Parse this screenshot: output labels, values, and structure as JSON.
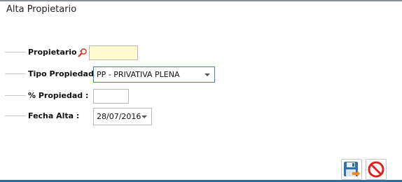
{
  "dialog": {
    "title": "Alta Propietario"
  },
  "form": {
    "propietario": {
      "label": "Propietario :",
      "value": ""
    },
    "tipo_propiedad": {
      "label": "Tipo Propiedad :",
      "selected": "PP - PRIVATIVA PLENA"
    },
    "porcentaje": {
      "label": "% Propiedad :",
      "value": ""
    },
    "fecha_alta": {
      "label": "Fecha Alta :",
      "selected": "28/07/2016"
    }
  },
  "toolbar": {
    "save_icon": "save-icon",
    "cancel_icon": "cancel-icon"
  },
  "colors": {
    "required_bg": "#fffbd0",
    "accent": "#2e6da4",
    "cancel": "#e02020"
  }
}
